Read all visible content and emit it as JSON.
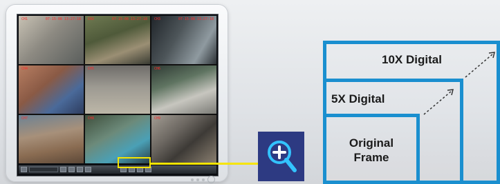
{
  "monitor": {
    "cameras": [
      {
        "id": "cam-1",
        "left": "CH1",
        "right": "07-15-08 13:27:18"
      },
      {
        "id": "cam-2",
        "left": "CH2",
        "right": "07-15-08 13:27:18"
      },
      {
        "id": "cam-3",
        "left": "CH3",
        "right": "07-15-08 13:27:18"
      },
      {
        "id": "cam-4",
        "left": "CH4",
        "right": ""
      },
      {
        "id": "cam-5",
        "left": "CH5",
        "right": ""
      },
      {
        "id": "cam-6",
        "left": "CH6",
        "right": ""
      },
      {
        "id": "cam-7",
        "left": "CH7",
        "right": ""
      },
      {
        "id": "cam-8",
        "left": "CH8",
        "right": ""
      },
      {
        "id": "cam-9",
        "left": "CH9",
        "right": ""
      }
    ]
  },
  "zoom": {
    "label_10x": "10X Digital",
    "label_5x": "5X Digital",
    "label_original_line1": "Original",
    "label_original_line2": "Frame"
  },
  "colors": {
    "highlight": "#f6e500",
    "zoom_border": "#1a8fcf",
    "magnifier_bg": "#2d3a82"
  }
}
